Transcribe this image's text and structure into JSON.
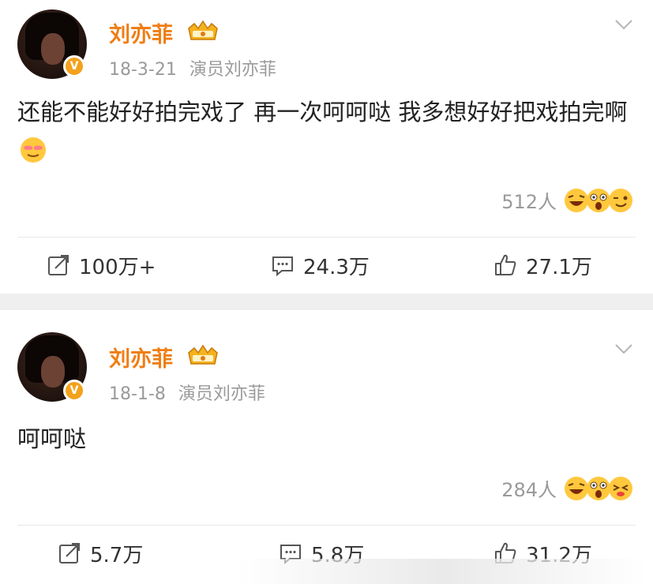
{
  "posts": [
    {
      "username": "刘亦菲",
      "date": "18-3-21",
      "verified_title": "演员刘亦菲",
      "text": "还能不能好好拍完戏了 再一次呵呵哒 我多想好好把戏拍完啊",
      "likes_people": "512人",
      "repost": "100万+",
      "comments": "24.3万",
      "likes": "27.1万"
    },
    {
      "username": "刘亦菲",
      "date": "18-1-8",
      "verified_title": "演员刘亦菲",
      "text": "呵呵哒",
      "likes_people": "284人",
      "repost": "5.7万",
      "comments": "5.8万",
      "likes": "31.2万"
    }
  ],
  "icons": {
    "crown": "crown-badge-icon",
    "verified": "verified-v-icon",
    "chevron": "chevron-down-icon",
    "repost": "repost-icon",
    "comment": "comment-icon",
    "like": "thumbs-up-icon",
    "emoji_cool": "cool-emoji-icon",
    "reaction_emojis": [
      "laugh-emoji-icon",
      "surprised-emoji-icon",
      "wink-emoji-icon"
    ]
  },
  "colors": {
    "username": "#f07d14",
    "meta": "#9a9a9a",
    "badge": "#f3a21c",
    "separator": "#efefef"
  }
}
